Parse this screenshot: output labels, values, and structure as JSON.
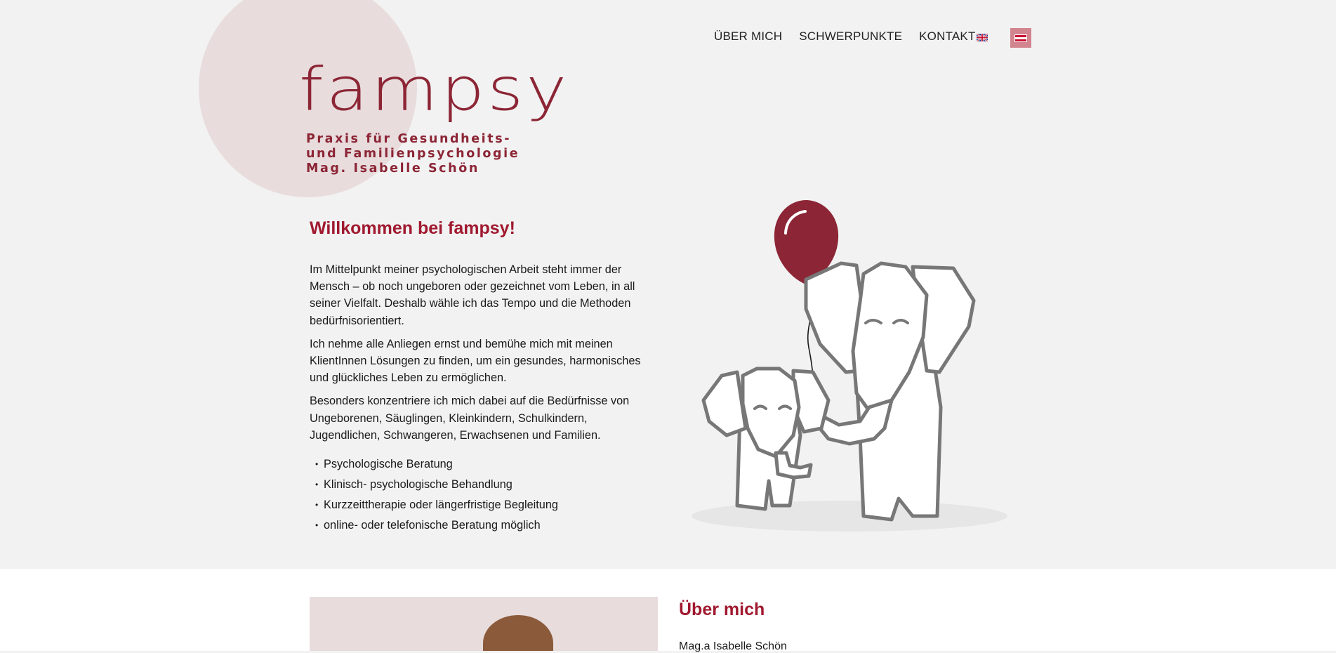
{
  "nav": {
    "items": [
      "ÜBER MICH",
      "SCHWERPUNKTE",
      "KONTAKT"
    ],
    "languages": [
      "english-flag",
      "austrian-flag"
    ]
  },
  "logo": {
    "word": "fampsy",
    "subtitle": [
      "Praxis für Gesundheits-",
      "und Familienpsychologie",
      "Mag. Isabelle Schön"
    ]
  },
  "welcome": {
    "title": "Willkommen bei fampsy!",
    "paragraphs": [
      "Im Mittelpunkt meiner psychologischen Arbeit steht immer der Mensch – ob noch ungeboren oder gezeichnet vom Leben, in all seiner Vielfalt. Deshalb wähle ich das Tempo und die Methoden bedürfnisorientiert.",
      "Ich nehme alle Anliegen ernst und bemühe mich mit meinen KlientInnen Lösungen zu finden, um ein gesundes, harmonisches und glückliches Leben zu ermöglichen.",
      "Besonders konzentriere ich mich dabei auf die Bedürfnisse von Ungeborenen, Säuglingen, Kleinkindern, Schulkindern, Jugendlichen, Schwangeren, Erwachsenen und Familien."
    ],
    "services": [
      "Psychologische Beratung",
      "Klinisch- psychologische Behandlung",
      "Kurzzeittherapie oder längerfristige Begleitung",
      "online- oder telefonische Beratung möglich"
    ]
  },
  "about": {
    "title": "Über mich",
    "name": "Mag.a Isabelle Schön"
  },
  "colors": {
    "accent": "#a0192f",
    "logo": "#8c2535",
    "circle": "#e8dcdd",
    "background": "#f2f2f2"
  }
}
